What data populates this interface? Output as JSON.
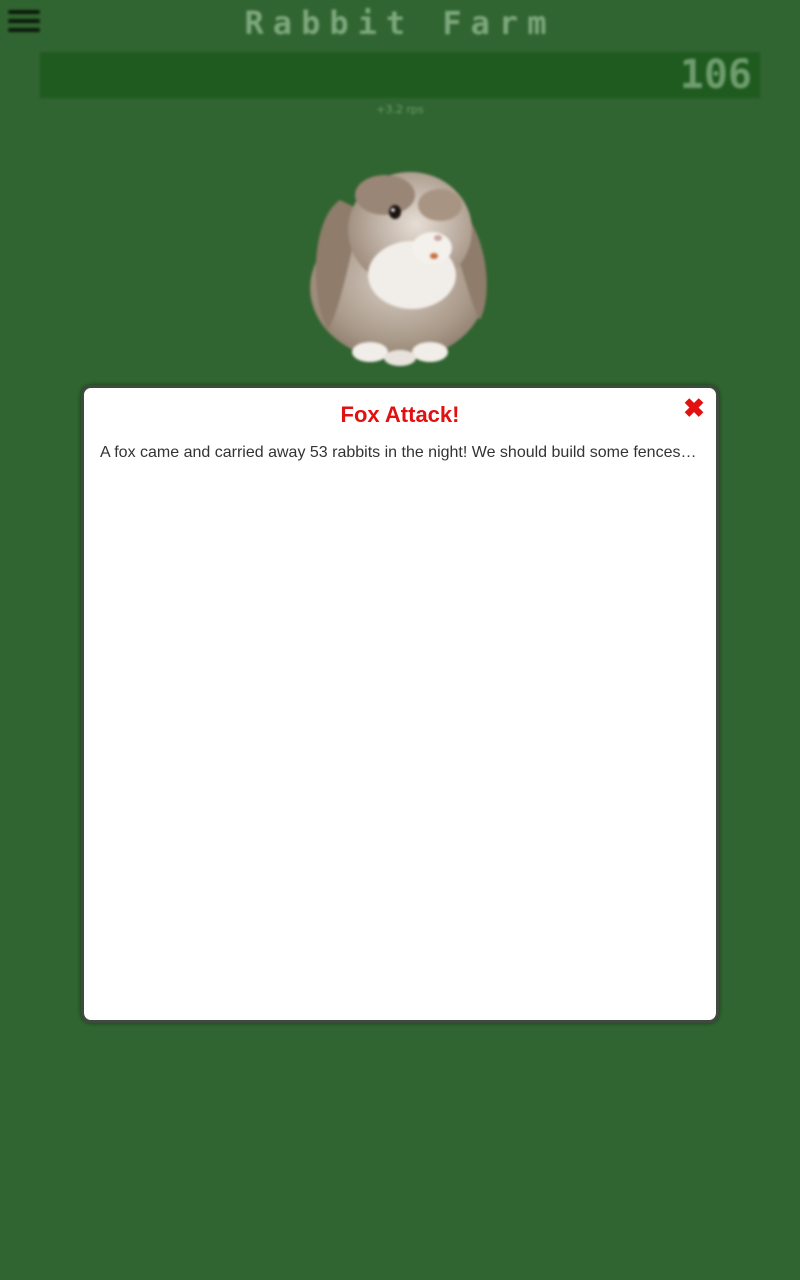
{
  "app": {
    "title": "Rabbit Farm",
    "menu_icon": "hamburger-menu-icon"
  },
  "counter": {
    "value": "106",
    "rate": "+3.2 rps"
  },
  "rabbit": {
    "image": "rabbit-image"
  },
  "modal": {
    "title": "Fox Attack!",
    "close_icon": "close-icon",
    "message": "A fox came and carried away 53 rabbits in the night! We should build some fences to keep them safe.",
    "accent_color": "#e21010"
  },
  "colors": {
    "background": "#306430",
    "counter_bar": "#1f5a1f"
  }
}
